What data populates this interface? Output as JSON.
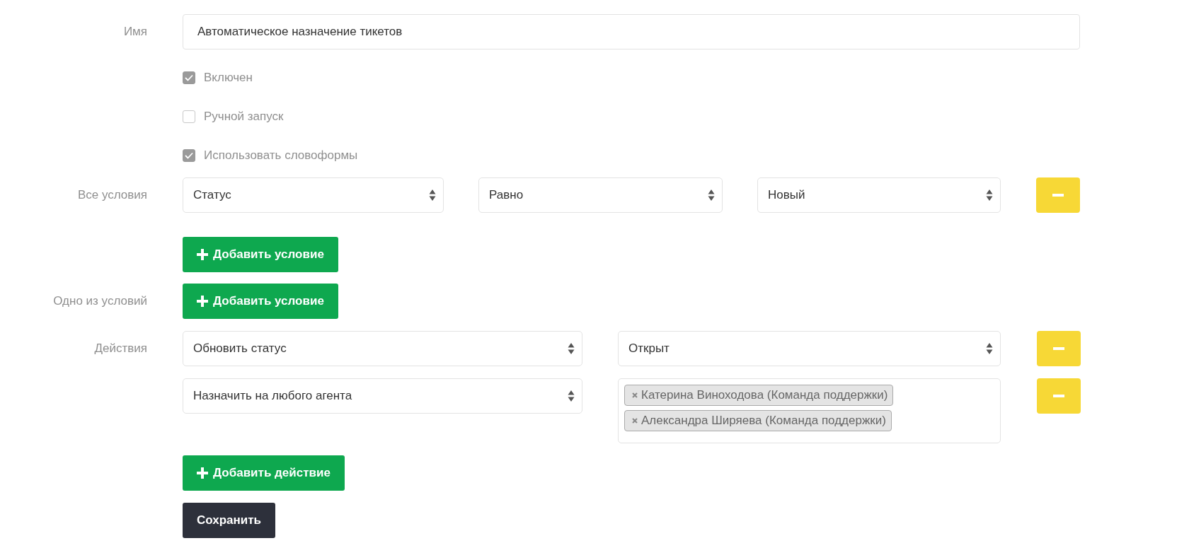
{
  "name_field": {
    "label": "Имя",
    "value": "Автоматическое назначение тикетов"
  },
  "checkboxes": [
    {
      "label": "Включен",
      "checked": true
    },
    {
      "label": "Ручной запуск",
      "checked": false
    },
    {
      "label": "Использовать словоформы",
      "checked": true
    }
  ],
  "all_conditions": {
    "label": "Все условия",
    "rows": [
      {
        "field": "Статус",
        "operator": "Равно",
        "value": "Новый"
      }
    ],
    "add_button": "Добавить условие"
  },
  "any_conditions": {
    "label": "Одно из условий",
    "add_button": "Добавить условие"
  },
  "actions": {
    "label": "Действия",
    "rows": [
      {
        "kind": "select",
        "action": "Обновить статус",
        "value": "Открыт"
      },
      {
        "kind": "tags",
        "action": "Назначить на любого агента",
        "tags": [
          "Катерина Виноходова (Команда поддержки)",
          "Александра Ширяева (Команда поддержки)"
        ]
      }
    ],
    "add_button": "Добавить действие"
  },
  "save_button": "Сохранить"
}
